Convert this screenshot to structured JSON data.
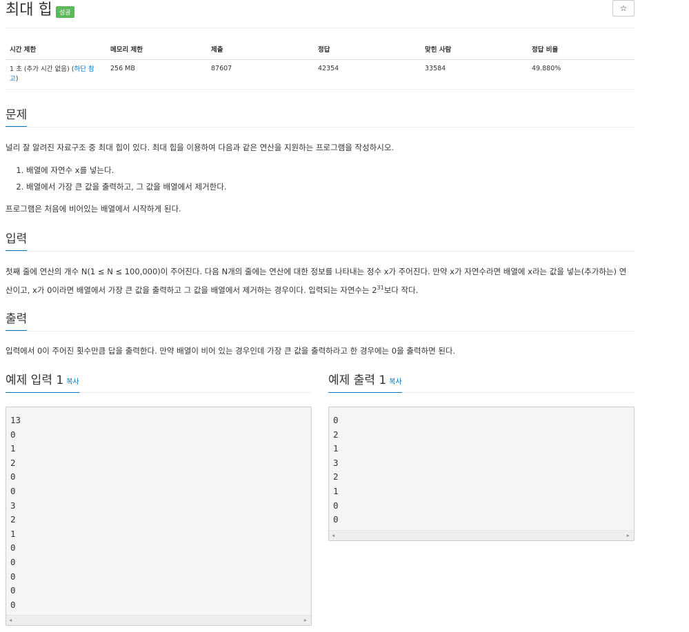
{
  "problem": {
    "title": "최대 힙",
    "badge": "성공",
    "star": "☆"
  },
  "stats": {
    "headers": [
      "시간 제한",
      "메모리 제한",
      "제출",
      "정답",
      "맞힌 사람",
      "정답 비율"
    ],
    "time_text": "1 초 (추가 시간 없음) (",
    "time_link": "하단 참고",
    "time_close": ")",
    "memory": "256 MB",
    "submissions": "87607",
    "accepted": "42354",
    "solvers": "33584",
    "ratio": "49.880%"
  },
  "sections": {
    "problem_head": "문제",
    "problem_p1": "널리 잘 알려진 자료구조 중 최대 힙이 있다. 최대 힙을 이용하여 다음과 같은 연산을 지원하는 프로그램을 작성하시오.",
    "problem_items": [
      "배열에 자연수 x를 넣는다.",
      "배열에서 가장 큰 값을 출력하고, 그 값을 배열에서 제거한다."
    ],
    "problem_p2": "프로그램은 처음에 비어있는 배열에서 시작하게 된다.",
    "input_head": "입력",
    "input_p_before": "첫째 줄에 연산의 개수 N(1 ≤ N ≤ 100,000)이 주어진다. 다음 N개의 줄에는 연산에 대한 정보를 나타내는 정수 x가 주어진다. 만약 x가 자연수라면 배열에 x라는 값을 넣는(추가하는) 연산이고, x가 0이라면 배열에서 가장 큰 값을 출력하고 그 값을 배열에서 제거하는 경우이다. 입력되는 자연수는 2",
    "input_sup": "31",
    "input_p_after": "보다 작다.",
    "output_head": "출력",
    "output_p": "입력에서 0이 주어진 횟수만큼 답을 출력한다. 만약 배열이 비어 있는 경우인데 가장 큰 값을 출력하라고 한 경우에는 0을 출력하면 된다."
  },
  "samples": {
    "copy_label": "복사",
    "input_title": "예제 입력 1",
    "output_title": "예제 출력 1",
    "input_lines": [
      "13",
      "0",
      "1",
      "2",
      "0",
      "0",
      "3",
      "2",
      "1",
      "0",
      "0",
      "0",
      "0",
      "0"
    ],
    "output_lines": [
      "0",
      "2",
      "1",
      "3",
      "2",
      "1",
      "0",
      "0"
    ],
    "scroll_left": "◀",
    "scroll_right": "▶"
  }
}
